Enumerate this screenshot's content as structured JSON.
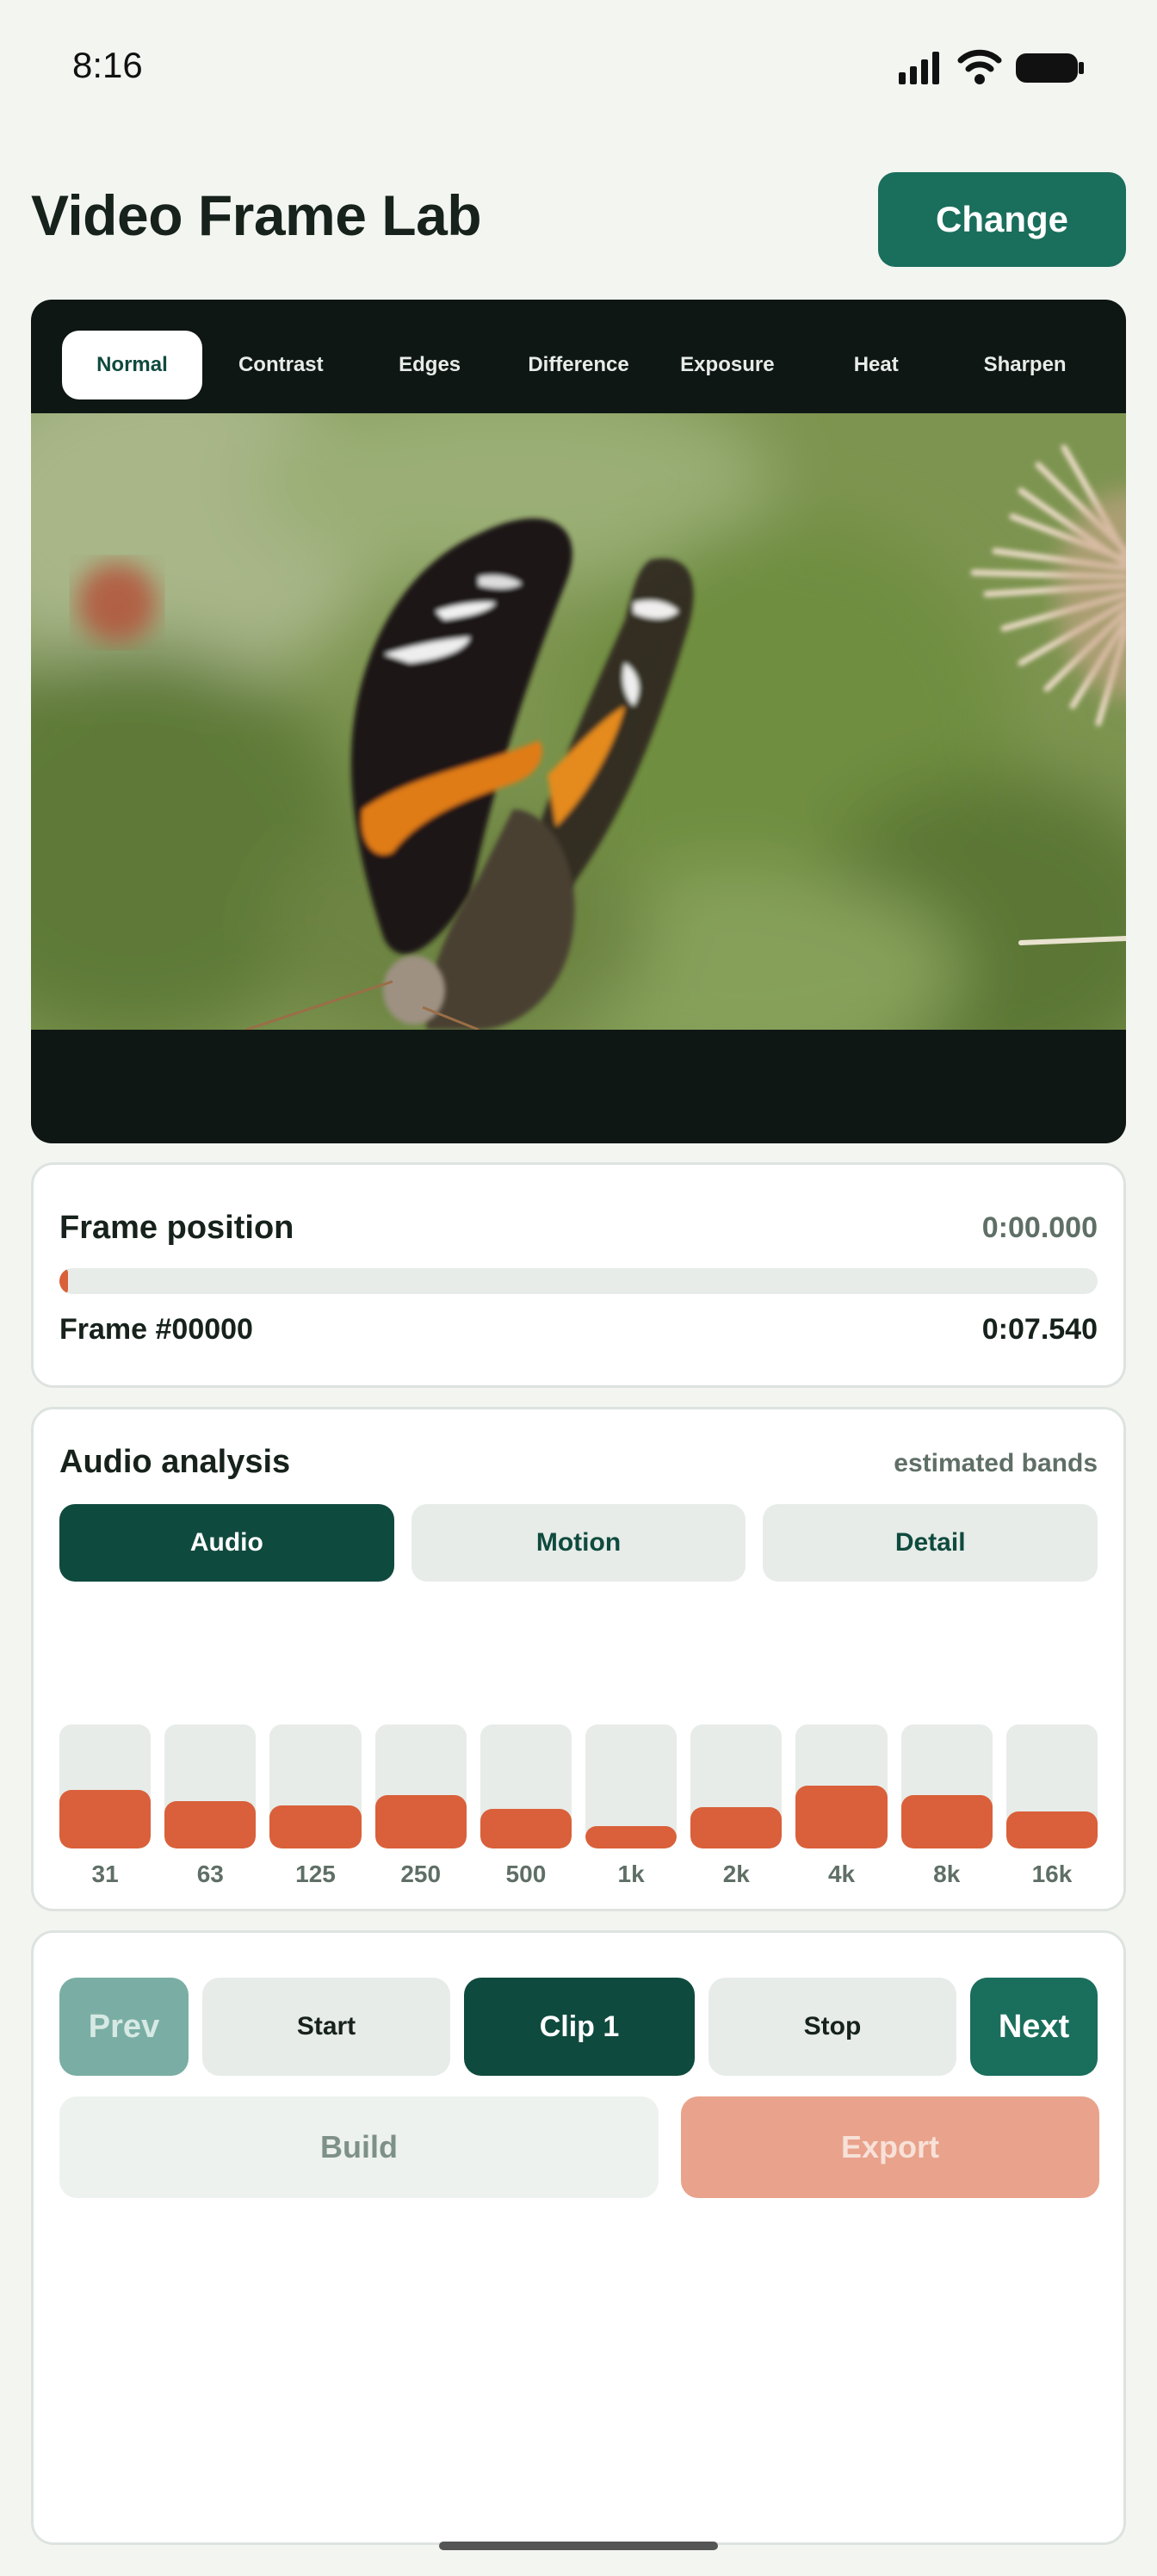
{
  "status_bar": {
    "time": "8:16",
    "icons": [
      "signal-icon",
      "wifi-icon",
      "battery-icon"
    ]
  },
  "header": {
    "title": "Video Frame Lab",
    "change_label": "Change"
  },
  "viewer": {
    "filters": [
      {
        "label": "Normal",
        "active": true
      },
      {
        "label": "Contrast",
        "active": false
      },
      {
        "label": "Edges",
        "active": false
      },
      {
        "label": "Difference",
        "active": false
      },
      {
        "label": "Exposure",
        "active": false
      },
      {
        "label": "Heat",
        "active": false
      },
      {
        "label": "Sharpen",
        "active": false
      }
    ]
  },
  "frame_position": {
    "title": "Frame position",
    "current_time": "0:00.000",
    "progress": 0.006,
    "frame_label": "Frame #00000",
    "duration": "0:07.540"
  },
  "audio_analysis": {
    "title": "Audio analysis",
    "note": "estimated bands",
    "modes": [
      {
        "label": "Audio",
        "active": true
      },
      {
        "label": "Motion",
        "active": false
      },
      {
        "label": "Detail",
        "active": false
      }
    ],
    "bands": [
      {
        "label": "31",
        "level": 0.47
      },
      {
        "label": "63",
        "level": 0.38
      },
      {
        "label": "125",
        "level": 0.35
      },
      {
        "label": "250",
        "level": 0.43
      },
      {
        "label": "500",
        "level": 0.32
      },
      {
        "label": "1k",
        "level": 0.18
      },
      {
        "label": "2k",
        "level": 0.33
      },
      {
        "label": "4k",
        "level": 0.51
      },
      {
        "label": "8k",
        "level": 0.43
      },
      {
        "label": "16k",
        "level": 0.3
      }
    ]
  },
  "controls": {
    "prev_label": "Prev",
    "start_label": "Start",
    "clip_label": "Clip 1",
    "stop_label": "Stop",
    "next_label": "Next",
    "build_label": "Build",
    "export_label": "Export"
  },
  "colors": {
    "primary": "#1a6e5c",
    "dark": "#0f4a3e",
    "accent": "#d9603a",
    "background": "#f3f5f1"
  }
}
